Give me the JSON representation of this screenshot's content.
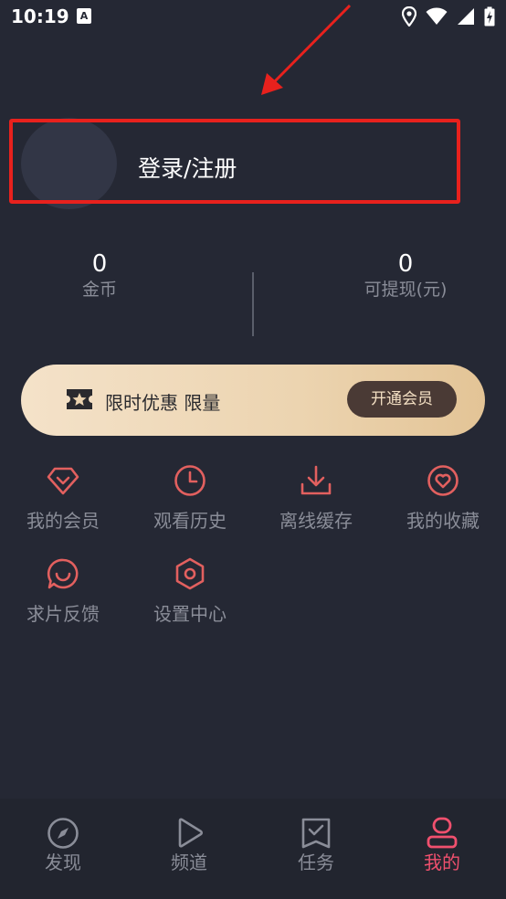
{
  "status_bar": {
    "time": "10:19",
    "notification_icon": "A"
  },
  "profile": {
    "login_label": "登录/注册"
  },
  "stats": {
    "coins_value": "0",
    "coins_label": "金币",
    "cash_value": "0",
    "cash_label": "可提现(元)"
  },
  "vip_banner": {
    "text": "限时优惠 限量",
    "button_label": "开通会员",
    "icon": "ticket-star-icon"
  },
  "features": [
    {
      "label": "我的会员",
      "icon": "diamond-icon"
    },
    {
      "label": "观看历史",
      "icon": "clock-icon"
    },
    {
      "label": "离线缓存",
      "icon": "download-icon"
    },
    {
      "label": "我的收藏",
      "icon": "heart-icon"
    },
    {
      "label": "求片反馈",
      "icon": "feedback-icon"
    },
    {
      "label": "设置中心",
      "icon": "settings-icon"
    }
  ],
  "tabbar": {
    "tabs": [
      {
        "label": "发现",
        "icon": "compass-icon"
      },
      {
        "label": "频道",
        "icon": "play-icon"
      },
      {
        "label": "任务",
        "icon": "task-icon"
      },
      {
        "label": "我的",
        "icon": "user-icon"
      }
    ],
    "active": "我的"
  },
  "colors": {
    "background": "#252834",
    "accent": "#f0506e",
    "icon_red": "#e2605f",
    "annotation_red": "#e8211d"
  }
}
